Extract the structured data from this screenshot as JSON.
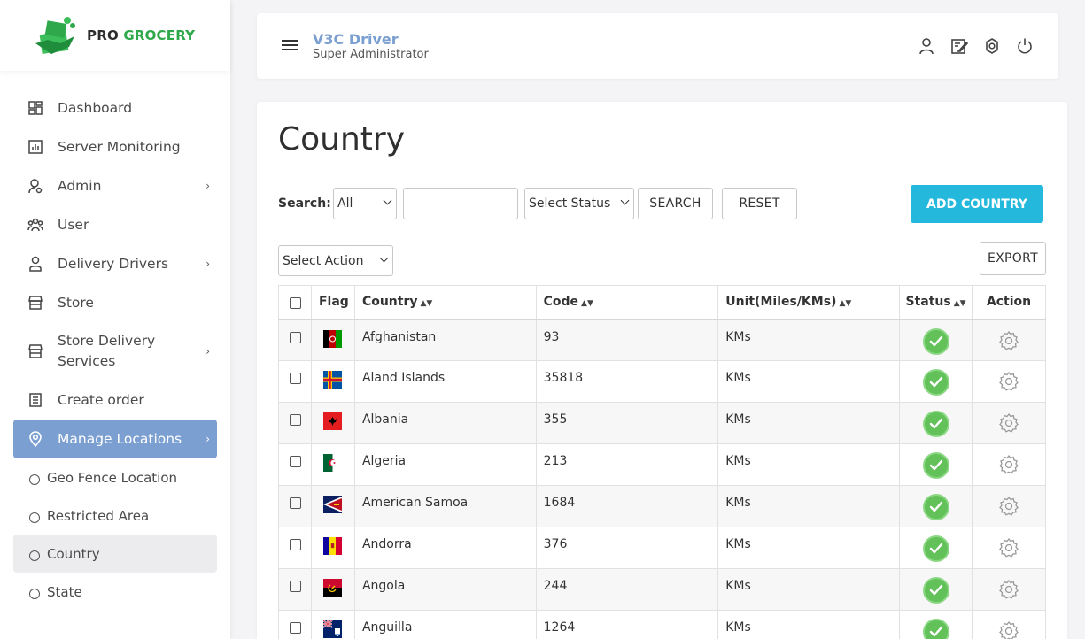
{
  "brand": {
    "pro": "PRO",
    "grocery": "GROCERY",
    "accent": "#2ea84a"
  },
  "sidebar": {
    "items": [
      {
        "label": "Dashboard",
        "icon": "dashboard-icon"
      },
      {
        "label": "Server Monitoring",
        "icon": "chart-icon"
      },
      {
        "label": "Admin",
        "icon": "admin-icon",
        "has_children": true
      },
      {
        "label": "User",
        "icon": "users-icon"
      },
      {
        "label": "Delivery Drivers",
        "icon": "driver-icon",
        "has_children": true
      },
      {
        "label": "Store",
        "icon": "store-icon"
      },
      {
        "label": "Store Delivery Services",
        "icon": "store-icon",
        "has_children": true
      },
      {
        "label": "Create order",
        "icon": "order-icon"
      },
      {
        "label": "Manage Locations",
        "icon": "location-icon",
        "has_children": true,
        "active": true
      }
    ],
    "sub_items": [
      {
        "label": "Geo Fence Location"
      },
      {
        "label": "Restricted Area"
      },
      {
        "label": "Country",
        "current": true
      },
      {
        "label": "State"
      }
    ],
    "active_color": "#7b9fd0"
  },
  "header": {
    "title": "V3C Driver",
    "subtitle": "Super Administrator",
    "icons": [
      "user-icon",
      "edit-icon",
      "settings-icon",
      "power-icon"
    ]
  },
  "page": {
    "title": "Country",
    "search_label": "Search:",
    "search_field_select": "All",
    "search_input_value": "",
    "status_select": "Select Status",
    "search_button": "SEARCH",
    "reset_button": "RESET",
    "add_button": "ADD COUNTRY",
    "action_select": "Select Action",
    "export_button": "EXPORT",
    "add_button_color": "#23b8dc"
  },
  "table": {
    "columns": [
      "Flag",
      "Country",
      "Code",
      "Unit(Miles/KMs)",
      "Status",
      "Action"
    ],
    "rows": [
      {
        "country": "Afghanistan",
        "code": "93",
        "unit": "KMs"
      },
      {
        "country": "Aland Islands",
        "code": "35818",
        "unit": "KMs"
      },
      {
        "country": "Albania",
        "code": "355",
        "unit": "KMs"
      },
      {
        "country": "Algeria",
        "code": "213",
        "unit": "KMs"
      },
      {
        "country": "American Samoa",
        "code": "1684",
        "unit": "KMs"
      },
      {
        "country": "Andorra",
        "code": "376",
        "unit": "KMs"
      },
      {
        "country": "Angola",
        "code": "244",
        "unit": "KMs"
      },
      {
        "country": "Anguilla",
        "code": "1264",
        "unit": "KMs"
      }
    ],
    "status_color": "#63c15a"
  }
}
